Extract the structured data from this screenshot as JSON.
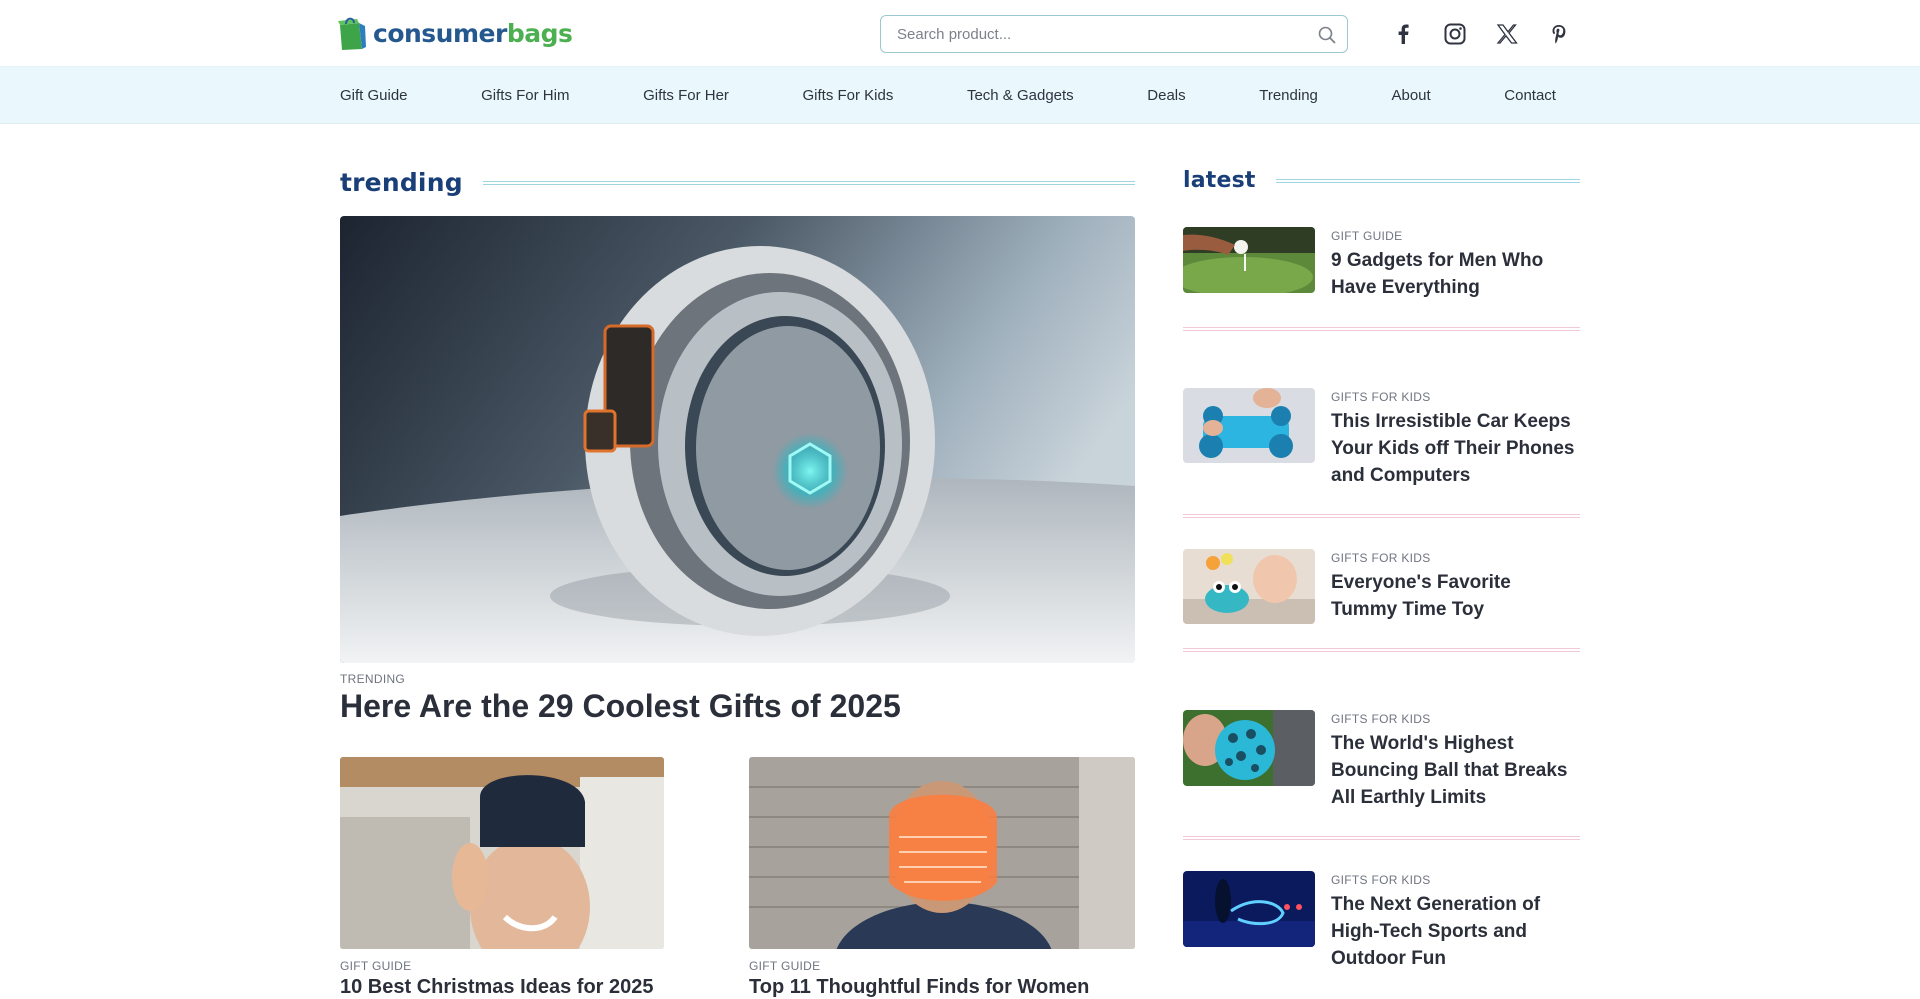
{
  "brand": {
    "name_part1": "consumer",
    "name_part2": "bags"
  },
  "search": {
    "placeholder": "Search product..."
  },
  "socials": [
    "facebook-icon",
    "instagram-icon",
    "x-icon",
    "pinterest-icon"
  ],
  "nav": {
    "items": [
      "Gift Guide",
      "Gifts For Him",
      "Gifts For Her",
      "Gifts For Kids",
      "Tech & Gadgets",
      "Deals",
      "Trending",
      "About",
      "Contact"
    ]
  },
  "trending": {
    "heading": "trending",
    "hero": {
      "kicker": "TRENDING",
      "title": "Here Are the 29 Coolest Gifts of 2025"
    },
    "cards": [
      {
        "kicker": "GIFT GUIDE",
        "title": "10 Best Christmas Ideas for 2025"
      },
      {
        "kicker": "GIFT GUIDE",
        "title": "Top 11 Thoughtful Finds for Women"
      }
    ]
  },
  "latest": {
    "heading": "latest",
    "items": [
      {
        "kicker": "GIFT GUIDE",
        "title": "9 Gadgets for Men Who Have Everything"
      },
      {
        "kicker": "GIFTS FOR KIDS",
        "title": "This Irresistible Car Keeps Your Kids off Their Phones and Computers"
      },
      {
        "kicker": "GIFTS FOR KIDS",
        "title": "Everyone's Favorite Tummy Time Toy"
      },
      {
        "kicker": "GIFTS FOR KIDS",
        "title": "The World's Highest Bouncing Ball that Breaks All Earthly Limits"
      },
      {
        "kicker": "GIFTS FOR KIDS",
        "title": "The Next Generation of High-Tech Sports and Outdoor Fun"
      }
    ]
  },
  "colors": {
    "brand_blue": "#24588e",
    "brand_green": "#4caf50",
    "heading_navy": "#1a3f78",
    "nav_bg": "#eaf7fc",
    "accent_line": "#9fd6e0",
    "divider_pink": "#f4c9d6"
  }
}
